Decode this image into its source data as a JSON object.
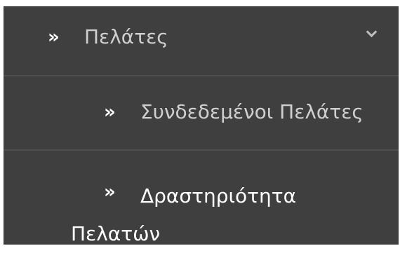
{
  "menu": {
    "parent": {
      "label": "Πελάτες",
      "bullet": "»",
      "expanded": true,
      "toggle_icon": "chevron-down-icon"
    },
    "items": [
      {
        "label": "Συνδεδεμένοι Πελάτες",
        "bullet": "»"
      },
      {
        "label": "Δραστηριότητα Πελατών",
        "bullet": "»"
      }
    ],
    "colors": {
      "background": "#3f3f3f",
      "divider": "#4f4f4f",
      "text_muted": "#cfcfcf",
      "text_active": "#ffffff"
    }
  }
}
